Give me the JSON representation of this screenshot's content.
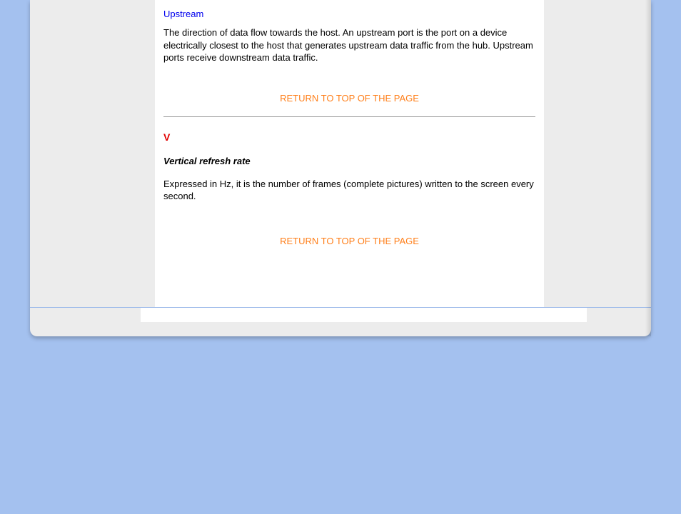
{
  "section_u": {
    "term_link": "Upstream",
    "definition": "The direction of data flow towards the host. An upstream port is the port on a device electrically closest to the host that generates upstream data traffic from the hub. Upstream ports receive downstream data traffic.",
    "return_text": "RETURN TO TOP OF THE PAGE"
  },
  "section_v": {
    "letter": "V",
    "term_title": "Vertical refresh rate",
    "definition": "Expressed in Hz, it is the number of frames (complete pictures) written to the screen every second.",
    "return_text": "RETURN TO TOP OF THE PAGE"
  }
}
